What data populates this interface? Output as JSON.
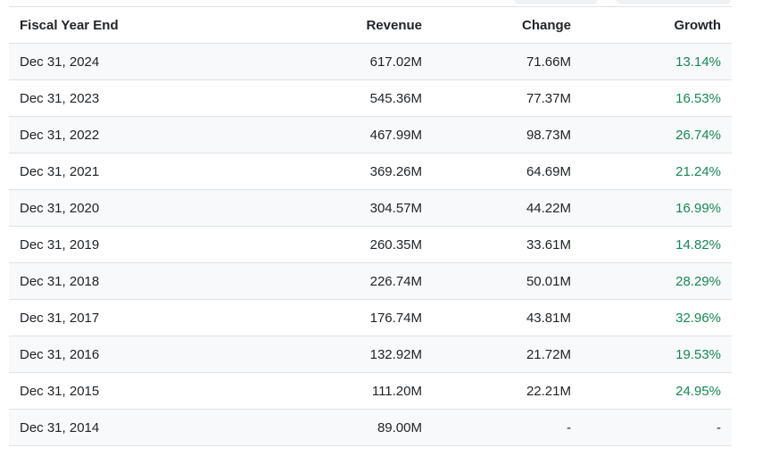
{
  "colors": {
    "growth_positive": "#198754",
    "text": "#212529",
    "border": "#dee2e6",
    "row_stripe": "#f8f9fa",
    "pill_button": "#f0f1f3"
  },
  "chart_data": {
    "type": "table",
    "title": "",
    "columns": [
      "Fiscal Year End",
      "Revenue",
      "Change",
      "Growth"
    ],
    "rows": [
      [
        "Dec 31, 2024",
        "617.02M",
        "71.66M",
        "13.14%"
      ],
      [
        "Dec 31, 2023",
        "545.36M",
        "77.37M",
        "16.53%"
      ],
      [
        "Dec 31, 2022",
        "467.99M",
        "98.73M",
        "26.74%"
      ],
      [
        "Dec 31, 2021",
        "369.26M",
        "64.69M",
        "21.24%"
      ],
      [
        "Dec 31, 2020",
        "304.57M",
        "44.22M",
        "16.99%"
      ],
      [
        "Dec 31, 2019",
        "260.35M",
        "33.61M",
        "14.82%"
      ],
      [
        "Dec 31, 2018",
        "226.74M",
        "50.01M",
        "28.29%"
      ],
      [
        "Dec 31, 2017",
        "176.74M",
        "43.81M",
        "32.96%"
      ],
      [
        "Dec 31, 2016",
        "132.92M",
        "21.72M",
        "19.53%"
      ],
      [
        "Dec 31, 2015",
        "111.20M",
        "22.21M",
        "24.95%"
      ],
      [
        "Dec 31, 2014",
        "89.00M",
        "-",
        "-"
      ]
    ]
  }
}
